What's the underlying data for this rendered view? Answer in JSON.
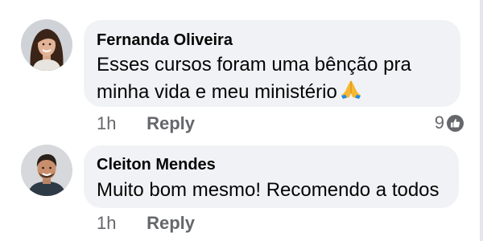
{
  "comments": [
    {
      "author": "Fernanda Oliveira",
      "text": "Esses cursos foram uma bênção pra minha vida e meu ministério",
      "emoji": "folded-hands-emoji",
      "time": "1h",
      "reply_label": "Reply",
      "reaction_count": "9",
      "reaction_icon": "like-icon"
    },
    {
      "author": "Cleiton Mendes",
      "text": "Muito bom mesmo! Recomendo a todos",
      "time": "1h",
      "reply_label": "Reply"
    }
  ],
  "colors": {
    "bubble_bg": "#f0f2f5",
    "text": "#050505",
    "meta": "#65676b"
  }
}
